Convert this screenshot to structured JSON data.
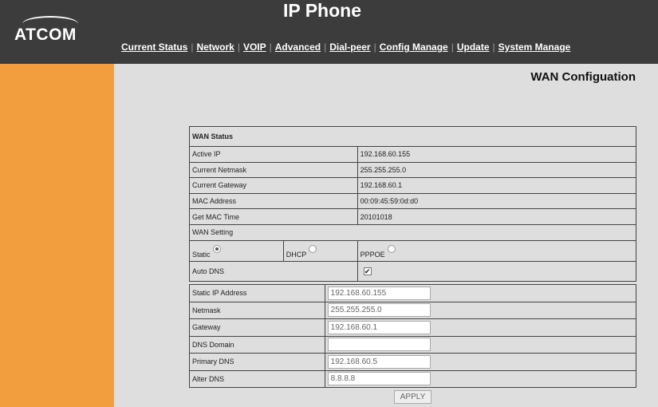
{
  "header": {
    "title": "IP Phone",
    "logo_text": "ATCOM"
  },
  "nav": [
    {
      "label": "Current Status"
    },
    {
      "label": "Network"
    },
    {
      "label": "VOIP"
    },
    {
      "label": "Advanced"
    },
    {
      "label": "Dial-peer"
    },
    {
      "label": "Config Manage"
    },
    {
      "label": "Update"
    },
    {
      "label": "System Manage"
    }
  ],
  "page": {
    "heading": "WAN Configuation"
  },
  "status": {
    "title": "WAN Status",
    "active_ip_label": "Active IP",
    "active_ip": "192.168.60.155",
    "netmask_label": "Current Netmask",
    "netmask": "255.255.255.0",
    "gateway_label": "Current Gateway",
    "gateway": "192.168.60.1",
    "mac_label": "MAC Address",
    "mac": "00:09:45:59:0d:d0",
    "mac_time_label": "Get MAC Time",
    "mac_time": "20101018"
  },
  "setting": {
    "title": "WAN Setting",
    "static_label": "Static",
    "dhcp_label": "DHCP",
    "pppoe_label": "PPPOE",
    "selected_mode": "Static",
    "auto_dns_label": "Auto DNS",
    "auto_dns_checked": true
  },
  "static_config": {
    "ip_label": "Static IP Address",
    "ip_value": "192.168.60.155",
    "netmask_label": "Netmask",
    "netmask_value": "255.255.255.0",
    "gateway_label": "Gateway",
    "gateway_value": "192.168.60.1",
    "dns_domain_label": "DNS Domain",
    "dns_domain_value": "",
    "primary_dns_label": "Primary DNS",
    "primary_dns_value": "192.168.60.5",
    "alter_dns_label": "Alter DNS",
    "alter_dns_value": "8.8.8.8"
  },
  "actions": {
    "apply_label": "APPLY"
  },
  "colors": {
    "header_bg": "#3c3c3c",
    "sidebar_bg": "#f29e3f",
    "content_bg": "#dedede"
  }
}
